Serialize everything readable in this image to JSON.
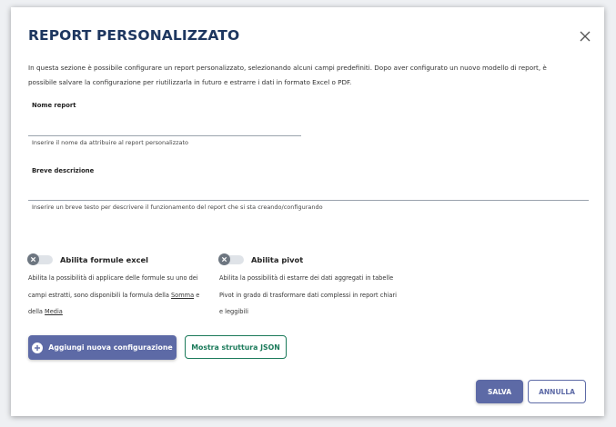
{
  "dialog": {
    "title": "REPORT PERSONALIZZATO",
    "close_icon": "close-icon",
    "intro_line1": "In questa sezione è possibile configurare un report personalizzato, selezionando alcuni campi predefiniti. Dopo aver configurato un nuovo modello di report, è",
    "intro_line2": "possibile salvare la configurazione per riutilizzarla in futuro e estrarre i dati in formato Excel o PDF."
  },
  "name_field": {
    "label": "Nome report",
    "value": "",
    "hint": "Inserire il nome da attribuire al report personalizzato"
  },
  "description_field": {
    "label": "Breve descrizione",
    "value": "",
    "hint": "Inserire un breve testo per descrivere il funzionamento del report che si sta creando/configurando"
  },
  "excel_toggle": {
    "label": "Abilita formule excel",
    "state": "off",
    "desc_line1": "Abilita la possibilità di applicare delle formule su uno dei",
    "desc_line2_prefix": "campi estratti, sono disponibili la formula della ",
    "link_somma": "Somma",
    "desc_line2_suffix": " e",
    "desc_line3_prefix": "della ",
    "link_media": "Media"
  },
  "pivot_toggle": {
    "label": "Abilita pivot",
    "state": "off",
    "desc_line1": "Abilita la possibilità di estarre dei dati aggregati in tabelle",
    "desc_line2": "Pivot in grado di trasformare dati complessi in report chiari",
    "desc_line3": "e leggibili"
  },
  "actions": {
    "add_config_label": "Aggiungi nuova configurazione",
    "show_json_label": "Mostra struttura JSON",
    "save_label": "SALVA",
    "cancel_label": "ANNULLA"
  },
  "colors": {
    "title": "#1e3760",
    "primary": "#5d6aa6",
    "json_button": "#1b7a5a",
    "toggle_knob": "#6d7680"
  }
}
